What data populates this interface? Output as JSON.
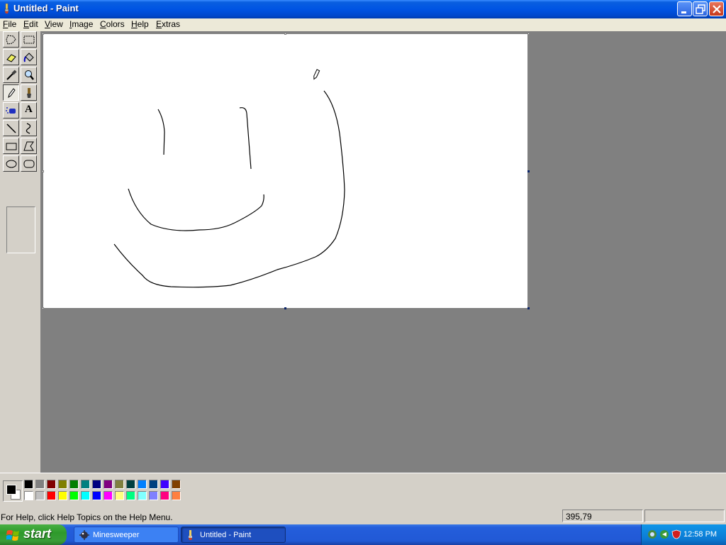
{
  "window": {
    "title": "Untitled - Paint"
  },
  "menu": [
    "File",
    "Edit",
    "View",
    "Image",
    "Colors",
    "Help",
    "Extras"
  ],
  "tools": [
    {
      "name": "free-form-select",
      "active": false
    },
    {
      "name": "select",
      "active": false
    },
    {
      "name": "eraser",
      "active": false
    },
    {
      "name": "fill-with-color",
      "active": false
    },
    {
      "name": "pick-color",
      "active": false
    },
    {
      "name": "magnifier",
      "active": false
    },
    {
      "name": "pencil",
      "active": true
    },
    {
      "name": "brush",
      "active": false
    },
    {
      "name": "airbrush",
      "active": false
    },
    {
      "name": "text",
      "active": false
    },
    {
      "name": "line",
      "active": false
    },
    {
      "name": "curve",
      "active": false
    },
    {
      "name": "rectangle",
      "active": false
    },
    {
      "name": "polygon",
      "active": false
    },
    {
      "name": "ellipse",
      "active": false
    },
    {
      "name": "rounded-rectangle",
      "active": false
    }
  ],
  "text_tool_glyph": "A",
  "palette": {
    "foreground": "#000000",
    "background": "#ffffff",
    "colors_top": [
      "#000000",
      "#808080",
      "#800000",
      "#808000",
      "#008000",
      "#008080",
      "#000080",
      "#800080",
      "#808040",
      "#004040",
      "#0080ff",
      "#004080",
      "#4000ff",
      "#804000"
    ],
    "colors_bottom": [
      "#ffffff",
      "#c0c0c0",
      "#ff0000",
      "#ffff00",
      "#00ff00",
      "#00ffff",
      "#0000ff",
      "#ff00ff",
      "#ffff80",
      "#00ff80",
      "#80ffff",
      "#8080ff",
      "#ff0080",
      "#ff8040"
    ]
  },
  "status": {
    "help_text": "For Help, click Help Topics on the Help Menu.",
    "cursor_position": "395,79",
    "size_panel": ""
  },
  "taskbar": {
    "start_label": "start",
    "tasks": [
      {
        "label": "Minesweeper",
        "active": false
      },
      {
        "label": "Untitled - Paint",
        "active": true
      }
    ],
    "clock": "12:58 PM"
  }
}
